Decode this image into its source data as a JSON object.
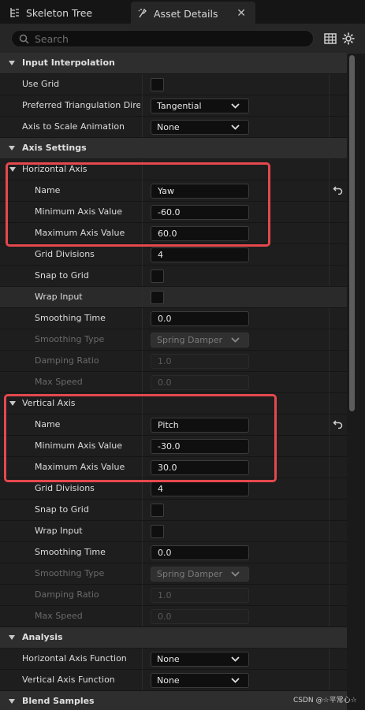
{
  "tabs": [
    {
      "label": "Skeleton Tree",
      "icon": "skeleton-tree-icon"
    },
    {
      "label": "Asset Details",
      "icon": "asset-details-icon",
      "close": "✕"
    }
  ],
  "search": {
    "placeholder": "Search"
  },
  "sections": {
    "input_interpolation": "Input Interpolation",
    "axis_settings": "Axis Settings",
    "horizontal_axis": "Horizontal Axis",
    "vertical_axis": "Vertical Axis",
    "analysis": "Analysis",
    "blend_samples": "Blend Samples"
  },
  "input_interpolation": {
    "use_grid": {
      "label": "Use Grid",
      "checked": false
    },
    "triangulation": {
      "label": "Preferred Triangulation Dire...",
      "value": "Tangential"
    },
    "axis_to_scale": {
      "label": "Axis to Scale Animation",
      "value": "None"
    }
  },
  "horizontal_axis": {
    "name": {
      "label": "Name",
      "value": "Yaw"
    },
    "min": {
      "label": "Minimum Axis Value",
      "value": "-60.0"
    },
    "max": {
      "label": "Maximum Axis Value",
      "value": "60.0"
    },
    "grid_divisions": {
      "label": "Grid Divisions",
      "value": "4"
    },
    "snap": {
      "label": "Snap to Grid"
    },
    "wrap": {
      "label": "Wrap Input"
    },
    "smoothing_time": {
      "label": "Smoothing Time",
      "value": "0.0"
    },
    "smoothing_type": {
      "label": "Smoothing Type",
      "value": "Spring Damper"
    },
    "damping_ratio": {
      "label": "Damping Ratio",
      "value": "1.0"
    },
    "max_speed": {
      "label": "Max Speed",
      "value": "0.0"
    }
  },
  "vertical_axis": {
    "name": {
      "label": "Name",
      "value": "Pitch"
    },
    "min": {
      "label": "Minimum Axis Value",
      "value": "-30.0"
    },
    "max": {
      "label": "Maximum Axis Value",
      "value": "30.0"
    },
    "grid_divisions": {
      "label": "Grid Divisions",
      "value": "4"
    },
    "snap": {
      "label": "Snap to Grid"
    },
    "wrap": {
      "label": "Wrap Input"
    },
    "smoothing_time": {
      "label": "Smoothing Time",
      "value": "0.0"
    },
    "smoothing_type": {
      "label": "Smoothing Type",
      "value": "Spring Damper"
    },
    "damping_ratio": {
      "label": "Damping Ratio",
      "value": "1.0"
    },
    "max_speed": {
      "label": "Max Speed",
      "value": "0.0"
    }
  },
  "analysis": {
    "horizontal_fn": {
      "label": "Horizontal Axis Function",
      "value": "None"
    },
    "vertical_fn": {
      "label": "Vertical Axis Function",
      "value": "None"
    }
  },
  "watermark": "CSDN @☆平常心☆",
  "colors": {
    "highlight": "#e5484d",
    "panel": "#1e1e1e",
    "category": "#2e2e2e"
  }
}
